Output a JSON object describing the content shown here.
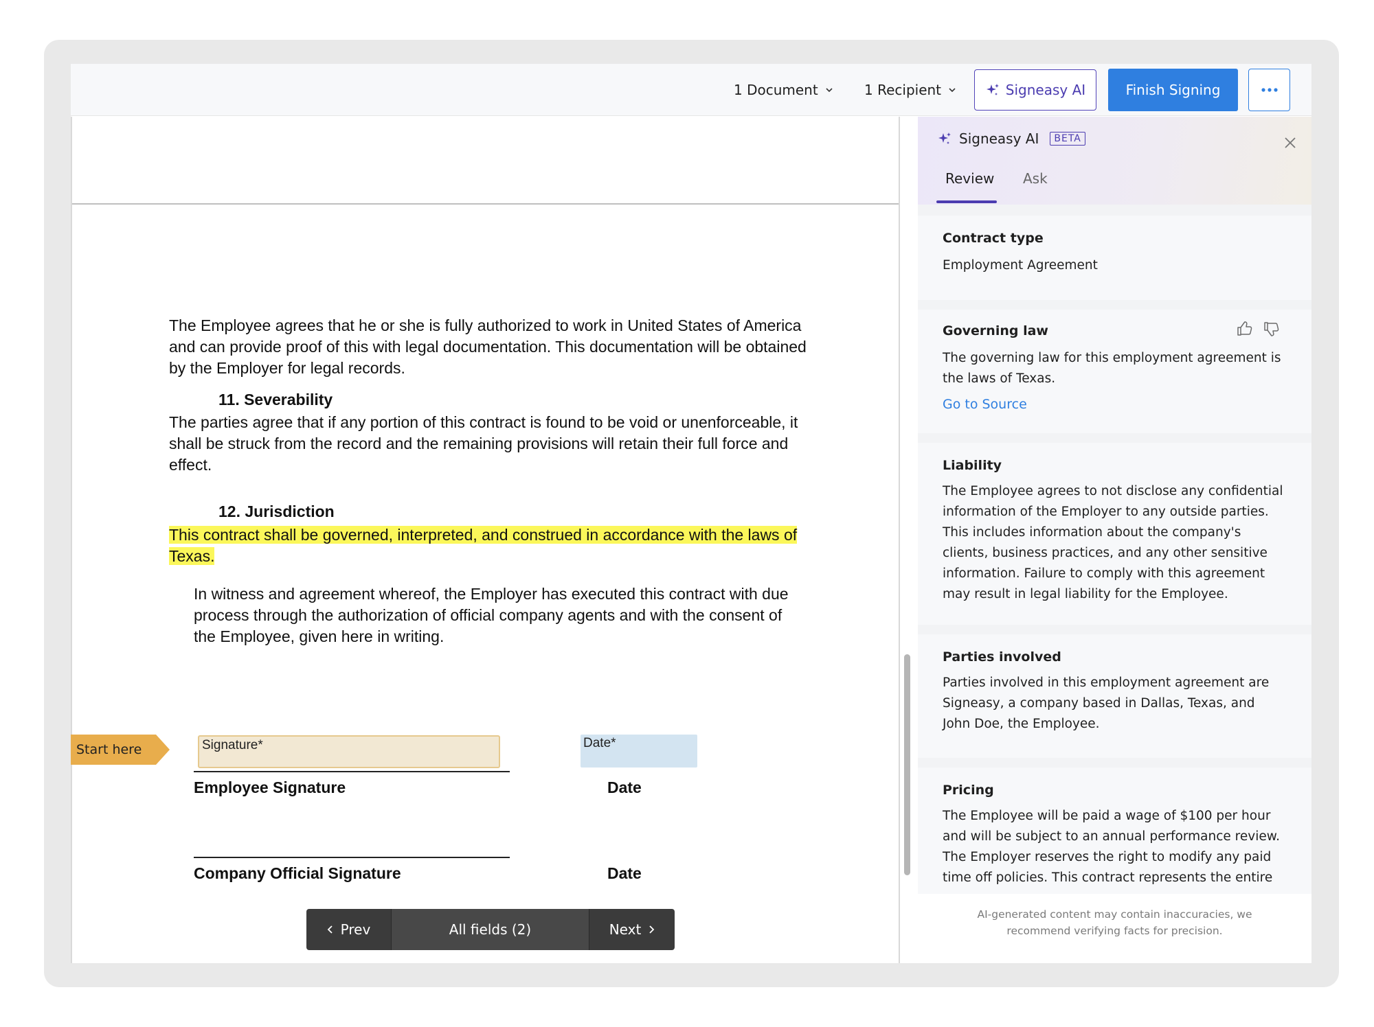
{
  "toolbar": {
    "documents_label": "1 Document",
    "recipients_label": "1 Recipient",
    "ai_label": "Signeasy AI",
    "finish_label": "Finish Signing"
  },
  "document": {
    "para_authorization": "The Employee agrees that he or she is fully authorized to work in United States of America and can provide proof of this with legal documentation. This documentation will be obtained by the Employer for legal records.",
    "heading_severability": "11. Severability",
    "para_severability": "The parties agree that if any portion of this contract is found to be void or unenforceable, it shall be struck from the record and the remaining provisions will retain their full force and effect.",
    "heading_jurisdiction": "12. Jurisdiction",
    "para_jurisdiction": "This contract shall be governed, interpreted, and construed in accordance with the laws of Texas.",
    "para_witness": "In witness and agreement whereof, the Employer has executed this contract with due process through the authorization of official company agents and with the consent of the Employee, given here in writing.",
    "start_here": "Start here",
    "signature_field": "Signature*",
    "date_field": "Date*",
    "employee_signature": "Employee Signature",
    "company_signature": "Company Official Signature",
    "date_label_1": "Date",
    "date_label_2": "Date"
  },
  "pager": {
    "prev": "Prev",
    "all_fields": "All fields (2)",
    "next": "Next"
  },
  "panel": {
    "title": "Signeasy AI",
    "badge": "BETA",
    "tabs": [
      {
        "label": "Review",
        "active": true
      },
      {
        "label": "Ask",
        "active": false
      }
    ],
    "cards": [
      {
        "title": "Contract type",
        "text": "Employment Agreement"
      },
      {
        "title": "Governing law",
        "text": "The governing law for this employment agreement is the laws of Texas.",
        "link": "Go to Source"
      },
      {
        "title": "Liability",
        "text": "The Employee agrees to not disclose any confidential information of the Employer to any outside parties. This includes information about the company's clients, business practices, and any other sensitive information. Failure to comply with this agreement may result in legal liability for the Employee."
      },
      {
        "title": "Parties involved",
        "text": "Parties involved in this employment agreement are Signeasy, a company based in Dallas, Texas, and John Doe, the Employee."
      },
      {
        "title": "Pricing",
        "text": "The Employee will be paid a wage of $100 per hour and will be subject to an annual performance review. The Employer reserves the right to modify any paid time off policies. This contract represents the entire"
      }
    ],
    "disclaimer": "AI-generated content may contain inaccuracies, we recommend verifying facts for precision."
  },
  "colors": {
    "accent_blue": "#2f7fe0",
    "ai_purple": "#4b3cb0",
    "highlight": "#fbf75a",
    "signature_field": "#f2e8d3",
    "date_field": "#d3e4f1",
    "start_here_tag": "#e8ad4c"
  },
  "icons": {
    "ai": "sparkle-icon",
    "more": "ellipsis-icon",
    "close": "close-icon",
    "feedback": [
      "thumbs-up-icon",
      "thumbs-down-icon"
    ]
  }
}
